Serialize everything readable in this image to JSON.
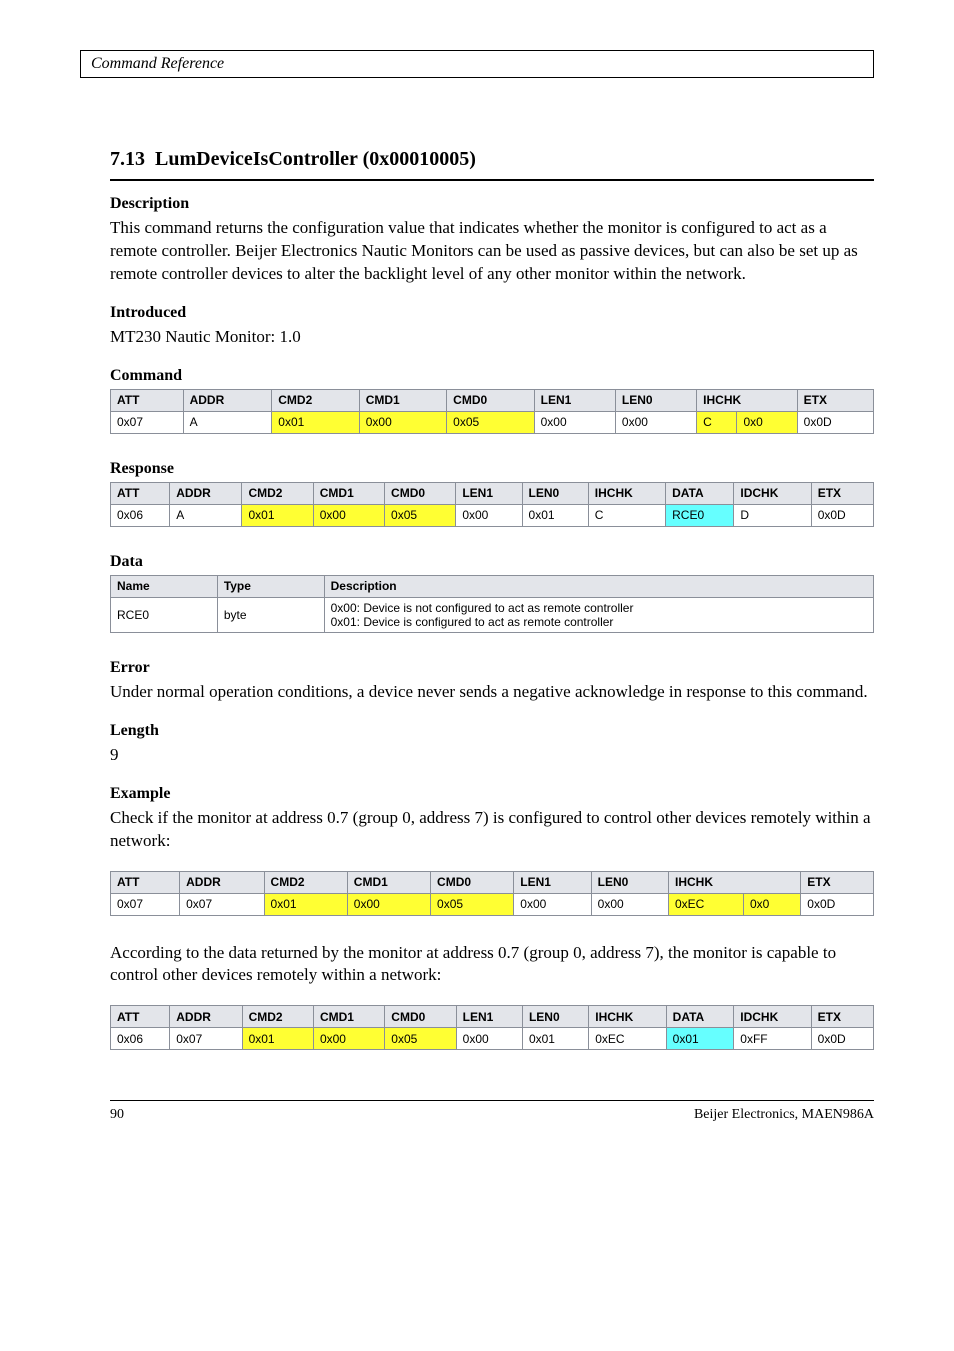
{
  "header": {
    "running": "Command Reference"
  },
  "section": {
    "number": "7.13",
    "title": "LumDeviceIsController (0x00010005)",
    "desc_label": "Description",
    "desc_text": "This command returns the configuration value that indicates whether the monitor is configured to act as a remote controller. Beijer Electronics Nautic Monitors can be used as passive devices, but can also be set up as remote controller devices to alter the backlight level of any other monitor within the network.",
    "intro_label": "Introduced",
    "intro_text": "MT230 Nautic Monitor: 1.0",
    "cmd_label": "Command",
    "resp_label": "Response"
  },
  "cmd_table": {
    "headers": [
      "ATT",
      "ADDR",
      "CMD2",
      "CMD1",
      "CMD0",
      "LEN1",
      "LEN0",
      "IHCHK",
      "ETX"
    ],
    "row": [
      "0x07",
      "A",
      "0x01",
      "0x00",
      "0x05",
      "0x00",
      "0x00",
      "C",
      "0x0",
      "0x0D"
    ],
    "yellow_idx": [
      2,
      3,
      4
    ],
    "yellow_extra": [
      7,
      8
    ]
  },
  "resp_table": {
    "headers": [
      "ATT",
      "ADDR",
      "CMD2",
      "CMD1",
      "CMD0",
      "LEN1",
      "LEN0",
      "IHCHK",
      "DATA",
      "IDCHK",
      "ETX"
    ],
    "row": [
      "0x06",
      "A",
      "0x01",
      "0x00",
      "0x05",
      "0x00",
      "0x01",
      "C",
      "RCE0",
      "D",
      "0x0D"
    ],
    "yellow_idx": [
      2,
      3,
      4
    ],
    "cyan_idx": [
      8
    ]
  },
  "data_label": "Data",
  "data_table": {
    "h_name": "Name",
    "h_type": "Type",
    "h_desc": "Description",
    "row_name": "RCE0",
    "row_type": "byte",
    "row_desc": "0x00: Device is not configured to act as remote controller\n0x01: Device is configured to act as remote controller"
  },
  "err_label": "Error",
  "err_text": "Under normal operation conditions, a device never sends a negative acknowledge in response to this command.",
  "len_label": "Length",
  "len_text": "9",
  "ex_label": "Example",
  "ex_text1": "Check if the monitor at address 0.7 (group 0, address 7) is configured to control other devices remotely within a network:",
  "ex_table1": {
    "headers": [
      "ATT",
      "ADDR",
      "CMD2",
      "CMD1",
      "CMD0",
      "LEN1",
      "LEN0",
      "IHCHK",
      "ETX"
    ],
    "row": [
      "0x07",
      "0x07",
      "0x01",
      "0x00",
      "0x05",
      "0x00",
      "0x00",
      "0xEC",
      "0x0",
      "0x0D"
    ],
    "yellow_idx": [
      2,
      3,
      4
    ],
    "yellow_extra": [
      7,
      8
    ]
  },
  "ex_text2": "According to the data returned by the monitor at address 0.7 (group 0, address 7), the monitor is capable to control other devices remotely within a network:",
  "ex_table2": {
    "headers": [
      "ATT",
      "ADDR",
      "CMD2",
      "CMD1",
      "CMD0",
      "LEN1",
      "LEN0",
      "IHCHK",
      "DATA",
      "IDCHK",
      "ETX"
    ],
    "row": [
      "0x06",
      "0x07",
      "0x01",
      "0x00",
      "0x05",
      "0x00",
      "0x01",
      "0xEC",
      "0x01",
      "0xFF",
      "0x0D"
    ],
    "yellow_idx": [
      2,
      3,
      4
    ],
    "cyan_idx": [
      8
    ]
  },
  "footer": {
    "page": "90",
    "company": "Beijer Electronics,",
    "doc": "MAEN986A"
  }
}
